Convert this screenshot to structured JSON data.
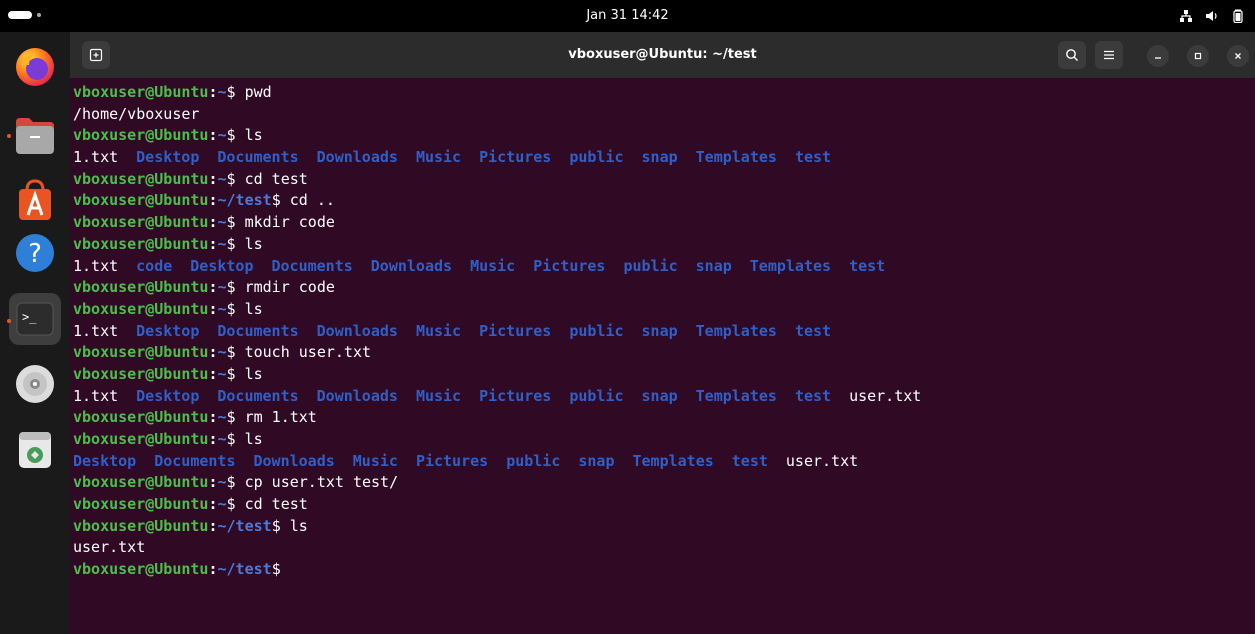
{
  "topbar": {
    "clock": "Jan 31  14:42"
  },
  "dock": {
    "apps": [
      {
        "name": "Firefox",
        "icon": "firefox-icon"
      },
      {
        "name": "Files",
        "icon": "files-icon",
        "running": true
      },
      {
        "name": "App Center",
        "icon": "app-center-icon"
      },
      {
        "name": "Help",
        "icon": "help-icon",
        "glyph": "?"
      },
      {
        "name": "Terminal",
        "icon": "terminal-icon",
        "glyph": ">_",
        "running": true,
        "active": true
      },
      {
        "name": "Disc",
        "icon": "disc-icon"
      },
      {
        "name": "Trash",
        "icon": "trash-icon"
      }
    ]
  },
  "window": {
    "title": "vboxuser@Ubuntu: ~/test"
  },
  "prompt": {
    "user_host": "vboxuser@Ubuntu",
    "colon": ":",
    "home_path": "~",
    "test_path": "~/test",
    "dollar": "$"
  },
  "terminal_lines": [
    {
      "type": "cmd",
      "path": "~",
      "command": " pwd"
    },
    {
      "type": "out",
      "text": "/home/vboxuser"
    },
    {
      "type": "cmd",
      "path": "~",
      "command": " ls"
    },
    {
      "type": "ls",
      "entries": [
        {
          "name": "1.txt",
          "kind": "file"
        },
        {
          "name": "Desktop",
          "kind": "dir"
        },
        {
          "name": "Documents",
          "kind": "dir"
        },
        {
          "name": "Downloads",
          "kind": "dir"
        },
        {
          "name": "Music",
          "kind": "dir"
        },
        {
          "name": "Pictures",
          "kind": "dir"
        },
        {
          "name": "public",
          "kind": "dir"
        },
        {
          "name": "snap",
          "kind": "dir"
        },
        {
          "name": "Templates",
          "kind": "dir"
        },
        {
          "name": "test",
          "kind": "dir"
        }
      ]
    },
    {
      "type": "cmd",
      "path": "~",
      "command": " cd test"
    },
    {
      "type": "cmd",
      "path": "~/test",
      "command": " cd .."
    },
    {
      "type": "cmd",
      "path": "~",
      "command": " mkdir code"
    },
    {
      "type": "cmd",
      "path": "~",
      "command": " ls"
    },
    {
      "type": "ls",
      "entries": [
        {
          "name": "1.txt",
          "kind": "file"
        },
        {
          "name": "code",
          "kind": "dir"
        },
        {
          "name": "Desktop",
          "kind": "dir"
        },
        {
          "name": "Documents",
          "kind": "dir"
        },
        {
          "name": "Downloads",
          "kind": "dir"
        },
        {
          "name": "Music",
          "kind": "dir"
        },
        {
          "name": "Pictures",
          "kind": "dir"
        },
        {
          "name": "public",
          "kind": "dir"
        },
        {
          "name": "snap",
          "kind": "dir"
        },
        {
          "name": "Templates",
          "kind": "dir"
        },
        {
          "name": "test",
          "kind": "dir"
        }
      ]
    },
    {
      "type": "cmd",
      "path": "~",
      "command": " rmdir code"
    },
    {
      "type": "cmd",
      "path": "~",
      "command": " ls"
    },
    {
      "type": "ls",
      "entries": [
        {
          "name": "1.txt",
          "kind": "file"
        },
        {
          "name": "Desktop",
          "kind": "dir"
        },
        {
          "name": "Documents",
          "kind": "dir"
        },
        {
          "name": "Downloads",
          "kind": "dir"
        },
        {
          "name": "Music",
          "kind": "dir"
        },
        {
          "name": "Pictures",
          "kind": "dir"
        },
        {
          "name": "public",
          "kind": "dir"
        },
        {
          "name": "snap",
          "kind": "dir"
        },
        {
          "name": "Templates",
          "kind": "dir"
        },
        {
          "name": "test",
          "kind": "dir"
        }
      ]
    },
    {
      "type": "cmd",
      "path": "~",
      "command": " touch user.txt"
    },
    {
      "type": "cmd",
      "path": "~",
      "command": " ls"
    },
    {
      "type": "ls",
      "entries": [
        {
          "name": "1.txt",
          "kind": "file"
        },
        {
          "name": "Desktop",
          "kind": "dir"
        },
        {
          "name": "Documents",
          "kind": "dir"
        },
        {
          "name": "Downloads",
          "kind": "dir"
        },
        {
          "name": "Music",
          "kind": "dir"
        },
        {
          "name": "Pictures",
          "kind": "dir"
        },
        {
          "name": "public",
          "kind": "dir"
        },
        {
          "name": "snap",
          "kind": "dir"
        },
        {
          "name": "Templates",
          "kind": "dir"
        },
        {
          "name": "test",
          "kind": "dir"
        },
        {
          "name": "user.txt",
          "kind": "file"
        }
      ]
    },
    {
      "type": "cmd",
      "path": "~",
      "command": " rm 1.txt"
    },
    {
      "type": "cmd",
      "path": "~",
      "command": " ls"
    },
    {
      "type": "ls",
      "entries": [
        {
          "name": "Desktop",
          "kind": "dir"
        },
        {
          "name": "Documents",
          "kind": "dir"
        },
        {
          "name": "Downloads",
          "kind": "dir"
        },
        {
          "name": "Music",
          "kind": "dir"
        },
        {
          "name": "Pictures",
          "kind": "dir"
        },
        {
          "name": "public",
          "kind": "dir"
        },
        {
          "name": "snap",
          "kind": "dir"
        },
        {
          "name": "Templates",
          "kind": "dir"
        },
        {
          "name": "test",
          "kind": "dir"
        },
        {
          "name": "user.txt",
          "kind": "file"
        }
      ]
    },
    {
      "type": "cmd",
      "path": "~",
      "command": " cp user.txt test/"
    },
    {
      "type": "cmd",
      "path": "~",
      "command": " cd test"
    },
    {
      "type": "cmd",
      "path": "~/test",
      "command": " ls"
    },
    {
      "type": "out",
      "text": "user.txt"
    },
    {
      "type": "cmd",
      "path": "~/test",
      "command": ""
    }
  ],
  "colors": {
    "terminal_bg": "#300a24",
    "prompt_user": "#4ac04a",
    "prompt_path": "#4a7bd8",
    "dir_entry": "#2f5fc8",
    "accent": "#e95420"
  }
}
